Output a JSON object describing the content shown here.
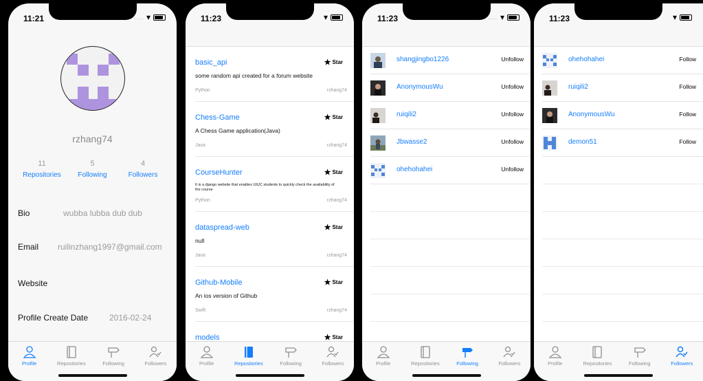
{
  "status_times": [
    "11:21",
    "11:23",
    "11:23",
    "11:23"
  ],
  "tabs": [
    "Profile",
    "Repositories",
    "Following",
    "Followers"
  ],
  "profile": {
    "username": "rzhang74",
    "stats": [
      {
        "num": "11",
        "label": "Repositories"
      },
      {
        "num": "5",
        "label": "Following"
      },
      {
        "num": "4",
        "label": "Followers"
      }
    ],
    "bio_label": "Bio",
    "bio": "wubba lubba dub dub",
    "email_label": "Email",
    "email": "ruilinzhang1997@gmail.com",
    "website_label": "Website",
    "created_label": "Profile Create Date",
    "created": "2016-02-24"
  },
  "repos": [
    {
      "name": "basic_api",
      "desc": "some random api created for a forum website",
      "lang": "Python",
      "owner": "rzhang74",
      "star": "Star"
    },
    {
      "name": "Chess-Game",
      "desc": "A Chess Game application(Java)",
      "lang": "Java",
      "owner": "rzhang74",
      "star": "Star"
    },
    {
      "name": "CourseHunter",
      "desc": "It is a django website that enables UIUC students to quickly check the availability of the course",
      "lang": "Python",
      "owner": "rzhang74",
      "star": "Star"
    },
    {
      "name": "dataspread-web",
      "desc": "null",
      "lang": "Java",
      "owner": "rzhang74",
      "star": "Star"
    },
    {
      "name": "Github-Mobile",
      "desc": "An ios version of Github",
      "lang": "Swift",
      "owner": "rzhang74",
      "star": "Star"
    },
    {
      "name": "models",
      "desc": "",
      "lang": "",
      "owner": "",
      "star": "Star"
    }
  ],
  "following": [
    {
      "name": "shangjingbo1226",
      "action": "Unfollow",
      "avatar": "photo-portrait"
    },
    {
      "name": "AnonymousWu",
      "action": "Unfollow",
      "avatar": "photo-dark"
    },
    {
      "name": "ruiqili2",
      "action": "Unfollow",
      "avatar": "photo-person"
    },
    {
      "name": "Jbwasse2",
      "action": "Unfollow",
      "avatar": "photo-outdoor"
    },
    {
      "name": "ohehohahei",
      "action": "Unfollow",
      "avatar": "identicon-blue"
    }
  ],
  "followers": [
    {
      "name": "ohehohahei",
      "action": "Follow",
      "avatar": "identicon-blue"
    },
    {
      "name": "ruiqili2",
      "action": "Follow",
      "avatar": "photo-person"
    },
    {
      "name": "AnonymousWu",
      "action": "Follow",
      "avatar": "photo-dark"
    },
    {
      "name": "demon51",
      "action": "Follow",
      "avatar": "identicon-blue2"
    }
  ],
  "colors": {
    "accent": "#147efb",
    "identicon_purple": "#ae93df",
    "identicon_blue": "#4f86d9"
  }
}
